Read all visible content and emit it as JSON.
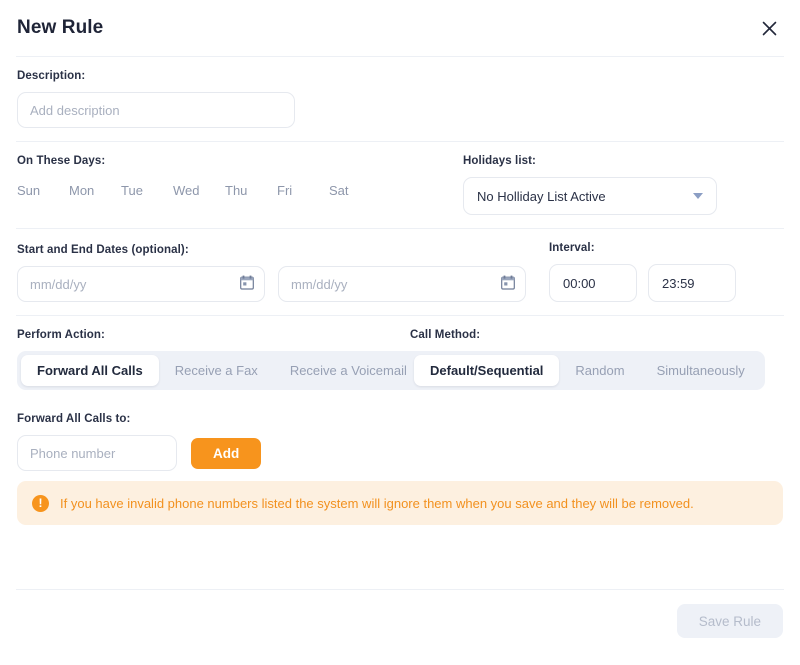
{
  "header": {
    "title": "New Rule",
    "close_icon": "close-icon"
  },
  "description": {
    "label": "Description:",
    "placeholder": "Add description",
    "value": ""
  },
  "days": {
    "label": "On These Days:",
    "items": [
      {
        "label": "Sun",
        "selected": false
      },
      {
        "label": "Mon",
        "selected": false
      },
      {
        "label": "Tue",
        "selected": false
      },
      {
        "label": "Wed",
        "selected": false
      },
      {
        "label": "Thu",
        "selected": false
      },
      {
        "label": "Fri",
        "selected": false
      },
      {
        "label": "Sat",
        "selected": false
      }
    ]
  },
  "holidays": {
    "label": "Holidays list:",
    "selected": "No Holliday List Active",
    "caret_icon": "chevron-down-icon"
  },
  "dates": {
    "label": "Start and End Dates (optional):",
    "start_placeholder": "mm/dd/yy",
    "end_placeholder": "mm/dd/yy",
    "calendar_icon": "calendar-icon"
  },
  "interval": {
    "label": "Interval:",
    "start_time": "00:00",
    "end_time": "23:59"
  },
  "perform_action": {
    "label": "Perform Action:",
    "options": [
      {
        "label": "Forward All Calls",
        "active": true
      },
      {
        "label": "Receive a Fax",
        "active": false
      },
      {
        "label": "Receive a Voicemail",
        "active": false
      }
    ]
  },
  "call_method": {
    "label": "Call Method:",
    "options": [
      {
        "label": "Default/Sequential",
        "active": true
      },
      {
        "label": "Random",
        "active": false
      },
      {
        "label": "Simultaneously",
        "active": false
      }
    ]
  },
  "forward_to": {
    "label": "Forward All Calls to:",
    "placeholder": "Phone number",
    "value": "",
    "add_label": "Add"
  },
  "warning": {
    "icon": "alert-circle-icon",
    "text": "If you have invalid phone numbers listed the system will ignore them when you save and they will be removed."
  },
  "footer": {
    "save_label": "Save Rule",
    "save_disabled": true
  },
  "colors": {
    "accent_orange": "#f7941d",
    "warning_bg": "#fdf0e0",
    "warning_text": "#f2911f",
    "segment_track": "#eef1f7",
    "title": "#1f2437",
    "muted": "#97a0b4"
  }
}
